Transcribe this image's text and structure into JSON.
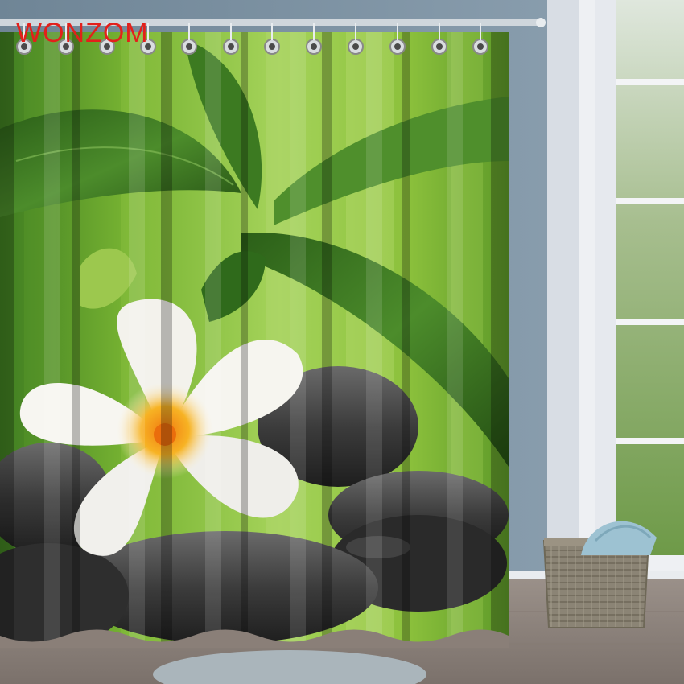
{
  "brand": {
    "text": "WONZOM",
    "color": "#e3201b"
  },
  "scene": {
    "subject": "product-photo-shower-curtain",
    "colors": {
      "wall": "#7d93a6",
      "curtain_green": "#8fc63a",
      "leaf_dark": "#2f6a1f",
      "flower_center": "#f19a12",
      "stones": "#3a3a3a",
      "floor": "#8a7f78",
      "window_frame": "#f2f2f4",
      "towel": "#9cc0cf",
      "basket": "#8d8676"
    }
  }
}
